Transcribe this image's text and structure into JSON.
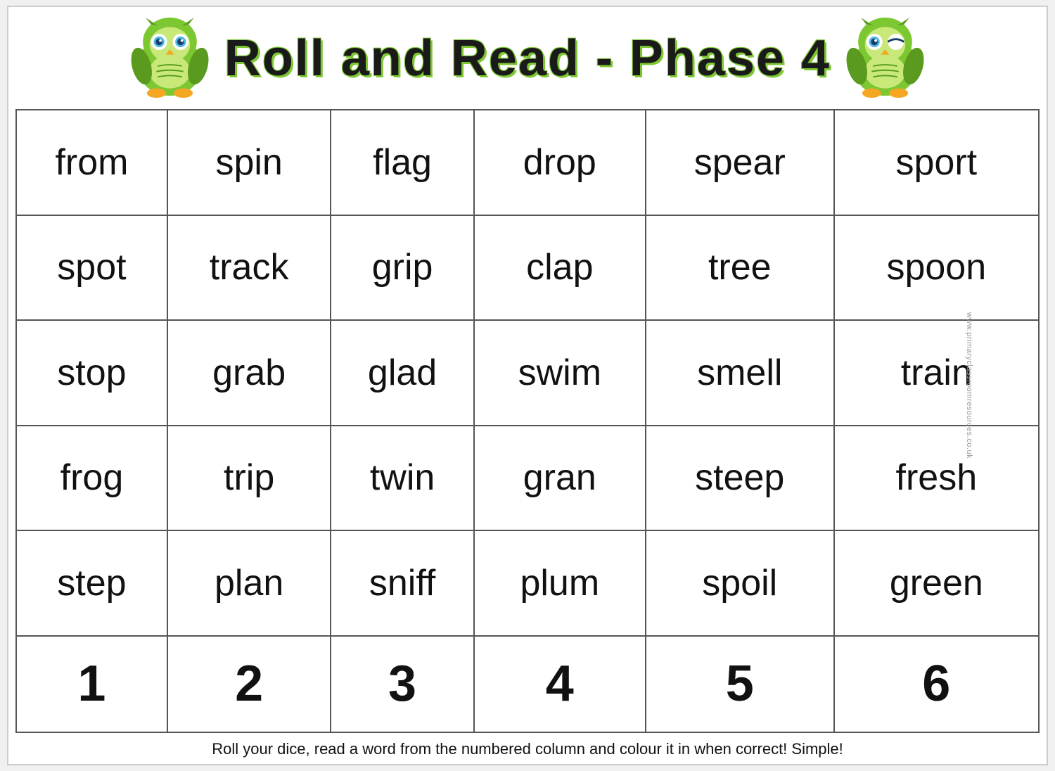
{
  "header": {
    "title": "Roll and Read - Phase 4"
  },
  "table": {
    "rows": [
      [
        "from",
        "spin",
        "flag",
        "drop",
        "spear",
        "sport"
      ],
      [
        "spot",
        "track",
        "grip",
        "clap",
        "tree",
        "spoon"
      ],
      [
        "stop",
        "grab",
        "glad",
        "swim",
        "smell",
        "train"
      ],
      [
        "frog",
        "trip",
        "twin",
        "gran",
        "steep",
        "fresh"
      ],
      [
        "step",
        "plan",
        "sniff",
        "plum",
        "spoil",
        "green"
      ],
      [
        "1",
        "2",
        "3",
        "4",
        "5",
        "6"
      ]
    ]
  },
  "footer": {
    "text": "Roll your dice, read a word from the numbered column and colour it in when correct!  Simple!"
  },
  "watermark": "www.primaryclassroomresources.co.uk"
}
